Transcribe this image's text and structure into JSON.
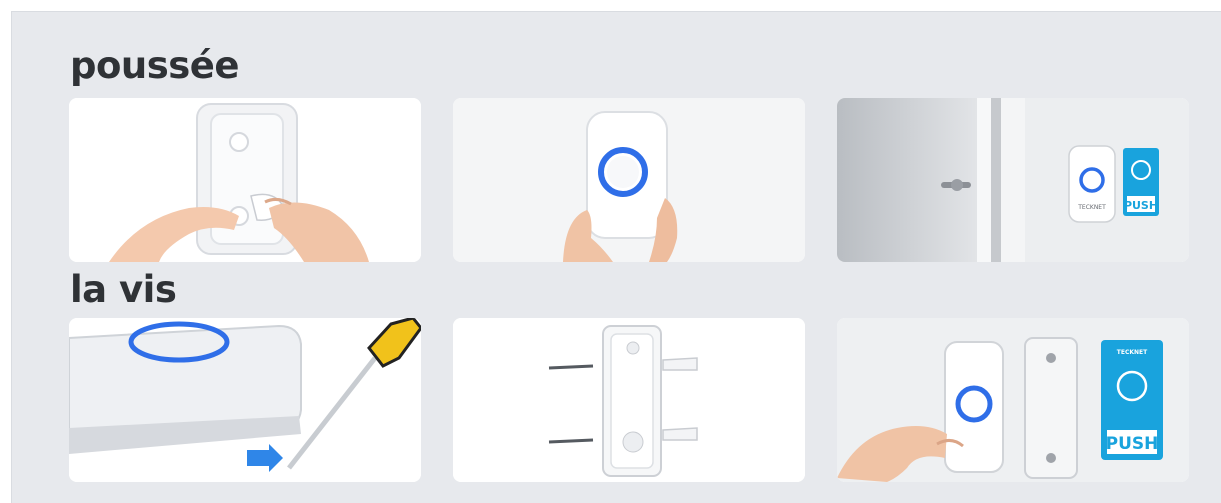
{
  "sections": [
    {
      "title": "poussée",
      "images": [
        {
          "icon": "adhesive-mounting-icon"
        },
        {
          "icon": "doorbell-on-wall-icon"
        },
        {
          "icon": "doorbell-beside-door-icon",
          "brand": "TECKNET",
          "sticker": "PUSH"
        }
      ]
    },
    {
      "title": "la vis",
      "images": [
        {
          "icon": "screwdriver-open-case-icon"
        },
        {
          "icon": "screws-and-anchors-icon"
        },
        {
          "icon": "screw-mounted-doorbell-icon",
          "brand": "TECKNET",
          "sticker": "PUSH"
        }
      ]
    }
  ],
  "colors": {
    "background": "#e7e9ed",
    "title": "#2f3236",
    "ring_blue": "#2f6ee8",
    "sticker_blue": "#19a3dd"
  }
}
